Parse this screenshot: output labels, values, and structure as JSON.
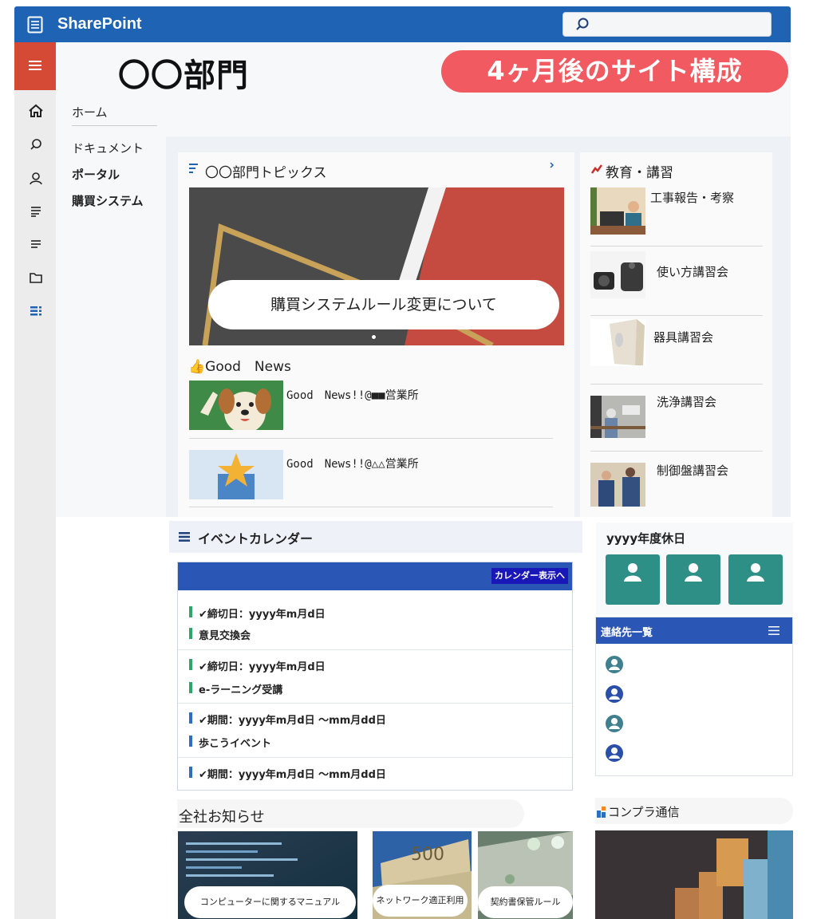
{
  "app": {
    "title": "SharePoint"
  },
  "site": {
    "title": "〇〇部門",
    "banner": "4ヶ月後のサイト構成"
  },
  "nav": {
    "items": [
      "ホーム",
      "ドキュメント",
      "ポータル",
      "購買システム"
    ]
  },
  "topics": {
    "title": "〇〇部門トピックス",
    "hero_caption": "購買システムルール変更について",
    "good_news_title": "👍Good　News",
    "good_news_items": [
      "Good　News!!@■■営業所",
      "Good　News!!@△△営業所"
    ]
  },
  "education": {
    "title": "教育・講習",
    "items": [
      "工事報告・考察",
      "使い方講習会",
      "器具講習会",
      "洗浄講習会",
      "制御盤講習会"
    ]
  },
  "events": {
    "title": "イベントカレンダー",
    "calendar_link": "カレンダー表示へ",
    "rows": [
      {
        "date": "✔締切日：yyyy年m月d日",
        "name": "意見交換会",
        "color": "#2fa56a"
      },
      {
        "date": "✔締切日：yyyy年m月d日",
        "name": "e-ラーニング受講",
        "color": "#2fa56a"
      },
      {
        "date": "✔期間：yyyy年m月d日 ～mm月dd日",
        "name": "歩こうイベント",
        "color": "#2a6fc4"
      },
      {
        "date": "✔期間：yyyy年m月d日 ～mm月dd日",
        "name": "",
        "color": "#2a6fc4"
      }
    ]
  },
  "holidays": {
    "title": "yyyy年度休日"
  },
  "contacts": {
    "title": "連絡先一覧"
  },
  "company_news": {
    "title": "全社お知らせ",
    "items": [
      "コンピューターに関するマニュアル",
      "ネットワーク適正利用",
      "契約書保管ルール"
    ]
  },
  "compliance": {
    "title": "コンプラ通信"
  },
  "colors": {
    "brand": "#1e63b4",
    "accent": "#d44a34",
    "banner": "#f05a60",
    "teal": "#2e8f87"
  }
}
